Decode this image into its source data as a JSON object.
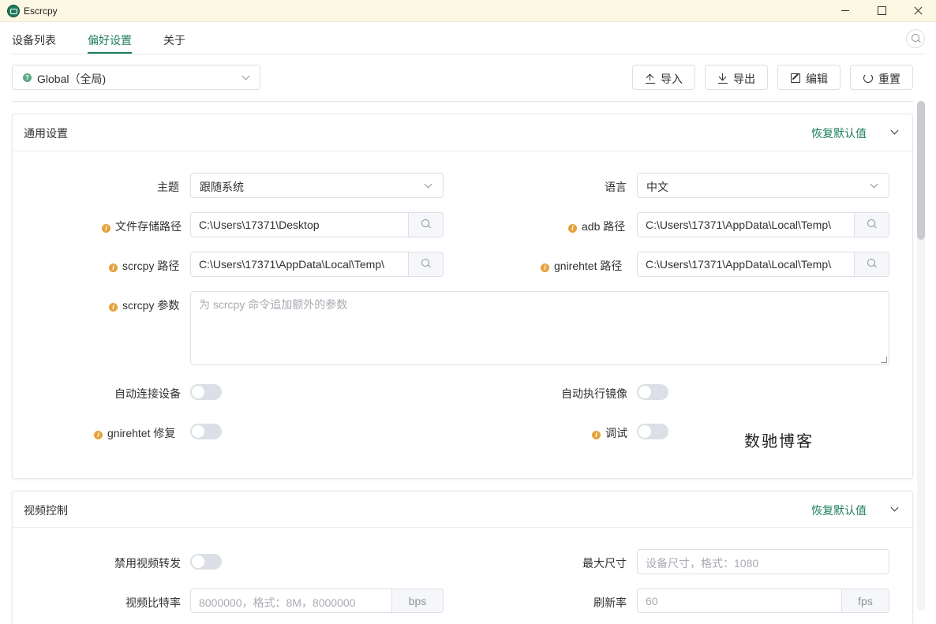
{
  "window": {
    "title": "Escrcpy"
  },
  "tabs": [
    {
      "label": "设备列表"
    },
    {
      "label": "偏好设置"
    },
    {
      "label": "关于"
    }
  ],
  "active_tab": "偏好设置",
  "preset": {
    "selected": "Global（全局)"
  },
  "toolbar": {
    "import_label": "导入",
    "export_label": "导出",
    "edit_label": "编辑",
    "reset_label": "重置"
  },
  "general": {
    "title": "通用设置",
    "restore_label": "恢复默认值",
    "theme": {
      "label": "主题",
      "value": "跟随系统"
    },
    "language": {
      "label": "语言",
      "value": "中文"
    },
    "save_path": {
      "label": "文件存储路径",
      "value": "C:\\Users\\17371\\Desktop"
    },
    "adb_path": {
      "label": "adb 路径",
      "value": "C:\\Users\\17371\\AppData\\Local\\Temp\\"
    },
    "scrcpy_path": {
      "label": "scrcpy 路径",
      "value": "C:\\Users\\17371\\AppData\\Local\\Temp\\"
    },
    "gnirehtet_path": {
      "label": "gnirehtet 路径",
      "value": "C:\\Users\\17371\\AppData\\Local\\Temp\\"
    },
    "scrcpy_args": {
      "label": "scrcpy 参数",
      "placeholder": "为 scrcpy 命令追加额外的参数"
    },
    "auto_connect": {
      "label": "自动连接设备",
      "on": false
    },
    "auto_mirror": {
      "label": "自动执行镜像",
      "on": false
    },
    "gnirehtet_fix": {
      "label": "gnirehtet 修复",
      "on": false
    },
    "debug": {
      "label": "调试",
      "on": false
    }
  },
  "watermark": "数驰博客",
  "video": {
    "title": "视频控制",
    "restore_label": "恢复默认值",
    "disable_video": {
      "label": "禁用视频转发",
      "on": false
    },
    "max_size": {
      "label": "最大尺寸",
      "placeholder": "设备尺寸，格式：1080"
    },
    "bitrate": {
      "label": "视频比特率",
      "placeholder": "8000000，格式：8M，8000000",
      "unit": "bps"
    },
    "refresh_rate": {
      "label": "刷新率",
      "placeholder": "60",
      "unit": "fps"
    }
  },
  "colors": {
    "accent": "#1e7d5e",
    "warning": "#e6a23c",
    "border": "#dcdfe6",
    "titlebar": "#fcf8e4"
  }
}
